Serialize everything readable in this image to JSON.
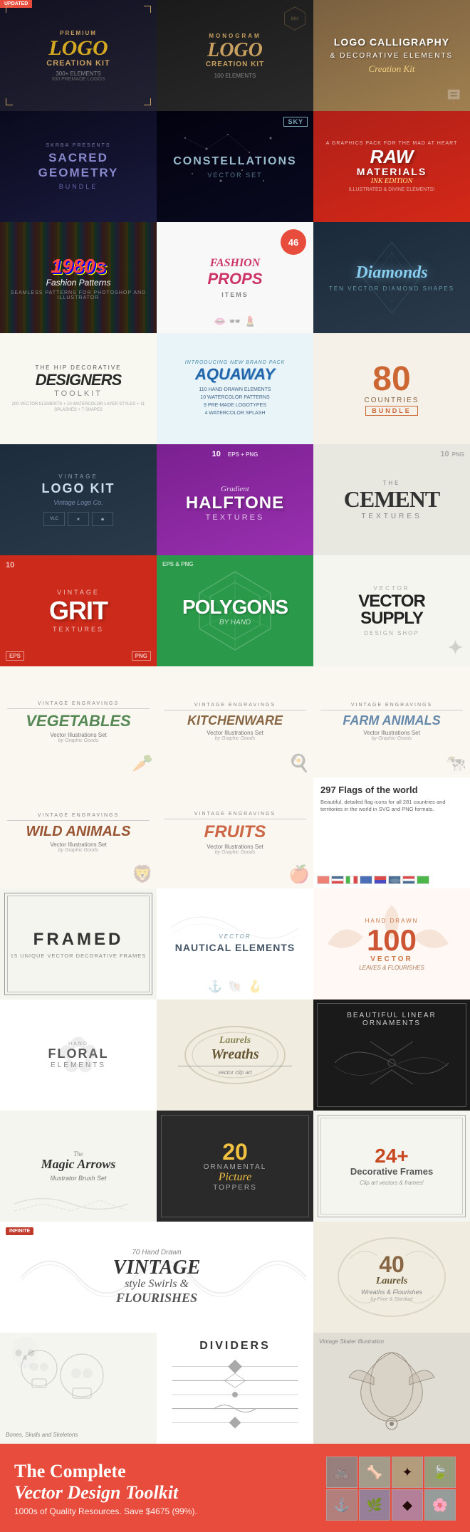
{
  "cells": {
    "r1c1": {
      "badge": "UPDATED",
      "label1": "PREMIUM",
      "title": "LOGO",
      "title2": "CREATION KIT",
      "sub1": "300+ ELEMENTS",
      "sub2": "300 PREMADE LOGOS"
    },
    "r1c2": {
      "label1": "MONOGRAM",
      "title": "LOGO",
      "title2": "CREATION KIT",
      "sub": "100 ELEMENTS"
    },
    "r1c3": {
      "title": "LOGO CALLIGRAPHY",
      "sub": "& DECORATIVE ELEMENTS",
      "label2": "Creation Kit"
    },
    "r2c1": {
      "label1": "SKRBA PRESENTS",
      "title": "SACRED GEOMETRY",
      "sub": "BUNDLE"
    },
    "r2c2": {
      "title": "CONSTELLATIONS",
      "sub": "VECTOR SET"
    },
    "r2c3": {
      "label1": "A GRAPHICS PACK FOR THE MAD AT HEART",
      "title": "RAW MATERIALS",
      "sub": "INK EDITION",
      "label2": "ILLUSTRATED & DIVINE ELEMENTS!"
    },
    "r3c1": {
      "title": "1980s",
      "sub": "Fashion Patterns",
      "label": "SEAMLESS PATTERNS FOR PHOTOSHOP AND ILLUSTRATOR"
    },
    "r3c2": {
      "label": "FASHION",
      "label2": "PROPS",
      "count": "46",
      "sub": "ITEMS"
    },
    "r3c3": {
      "title": "Diamonds",
      "sub": "TEN VECTOR DIAMOND SHAPES"
    },
    "r4c1": {
      "label": "THE HIP DECORATIVE",
      "title": "DESIGNERS",
      "sub": "TOOLKIT",
      "detail": "200 VECTOR ELEMENTS + 10 WATERCOLOR LAYER STYLES + 11 SPLASHES + 7 SHAPES"
    },
    "r4c2": {
      "label": "INTRODUCING NEW BRAND PACK",
      "title": "AQUAWAY",
      "sub1": "110 HAND-DRAWN ELEMENTS",
      "sub2": "10 WATERCOLOR PATTERNS",
      "sub3": "9 PRE-MADE LOGOTYPES",
      "sub4": "4 WATERCOLOR SPLASH"
    },
    "r4c3": {
      "count": "80",
      "sub": "COUNTRIES",
      "label": "BUNDLE"
    },
    "r5c1": {
      "label": "VINTAGE",
      "title": "LOGO KIT",
      "sub": "Vintage Logo Co."
    },
    "r5c2": {
      "count": "10",
      "label": "EPS + PNG",
      "title": "Gradient",
      "title2": "HALFTONE",
      "sub": "TEXTURES"
    },
    "r5c3": {
      "label": "THE",
      "count": "10",
      "label2": "PNG",
      "title": "CEMENT",
      "sub": "TEXTURES"
    },
    "r6c1": {
      "count": "10",
      "label": "VINTAGE",
      "title": "GRIT",
      "sub": "TEXTURES",
      "label2": "EPS",
      "label3": "PNG"
    },
    "r6c2": {
      "label": "EPS & PNG",
      "title": "POLYGONS",
      "sub": "BY HAND"
    },
    "r6c3": {
      "label": "Vector",
      "title": "VECTOR",
      "title2": "SUPPLY",
      "sub": "DESIGN SHOP"
    },
    "r7c1": {
      "label": "VINTAGE ENGRAVINGS",
      "title": "VEGETABLES",
      "sub": "Vector Illustrations Set",
      "detail": "by Graphic Goods"
    },
    "r7c2": {
      "label": "VINTAGE ENGRAVINGS",
      "title": "KITCHENWARE",
      "sub": "Vector Illustrations Set",
      "detail": "by Graphic Goods"
    },
    "r7c3": {
      "label": "VINTAGE ENGRAVINGS",
      "title": "FARM ANIMALS",
      "sub": "Vector Illustrations Set",
      "detail": "by Graphic Goods"
    },
    "r8c1": {
      "label": "VINTAGE ENGRAVINGS",
      "title": "WILD ANIMALS",
      "sub": "Vector Illustrations Set",
      "detail": "by Graphic Goods"
    },
    "r8c2": {
      "label": "VINTAGE ENGRAVINGS",
      "title": "FRUITS",
      "sub": "Vector Illustrations Set",
      "detail": "by Graphic Goods"
    },
    "r8c3": {
      "title": "297 Flags of the world",
      "sub": "Beautiful, detailed flag icons for all 281 countries and territories in the world in SVG and PNG formats."
    },
    "r9c1": {
      "title": "FRAMED",
      "sub": "15 UNIQUE VECTOR DECORATIVE FRAMES"
    },
    "r9c2": {
      "label": "Vector",
      "title": "NAUTICAL ELEMENTS"
    },
    "r9c3": {
      "label": "HAND DRAWN",
      "count": "100",
      "label2": "VECTOR",
      "sub": "LEAVES & FLOURISHES"
    },
    "r10c1": {
      "label": "HAND",
      "title": "FLORAL",
      "sub": "ELEMENTS"
    },
    "r10c2": {
      "label": "Laurels",
      "title": "Wreaths",
      "sub": "vector clip art"
    },
    "r10c3": {
      "label": "BEAUTIFUL LINEAR ORNAMENTS"
    },
    "r11c1": {
      "label": "The",
      "title": "Magic Arrows",
      "sub": "Illustrator Brush Set"
    },
    "r11c2": {
      "count": "20",
      "label": "ORNAMENTAL",
      "title": "Picture",
      "sub": "TOPPERS"
    },
    "r11c3": {
      "count": "24+",
      "label": "Decorative Frames",
      "sub": "Clip art vectors & frames!"
    },
    "r12c1": {
      "label": "70 Hand Drawn",
      "label2": "INFINITE",
      "title": "VINTAGE",
      "sub": "style Swirls &",
      "sub2": "FLOURISHES"
    },
    "r12c2": {
      "count": "40",
      "label": "Laurels",
      "sub": "Wreaths & Flourishes",
      "detail": "by Pixie & Stardust"
    },
    "r13c1": {
      "label": "Bones, Skulls and Skeletons"
    },
    "r13c2": {
      "label": "DIVIDERS"
    },
    "r13c3": {
      "label": "Vintage Skater Illustration"
    }
  },
  "footer": {
    "title_line1": "The Complete",
    "title_line2": "Vector Design Toolkit",
    "subtitle": "1000s of Quality Resources. Save $4675 (99%).",
    "flourish": "❧"
  }
}
